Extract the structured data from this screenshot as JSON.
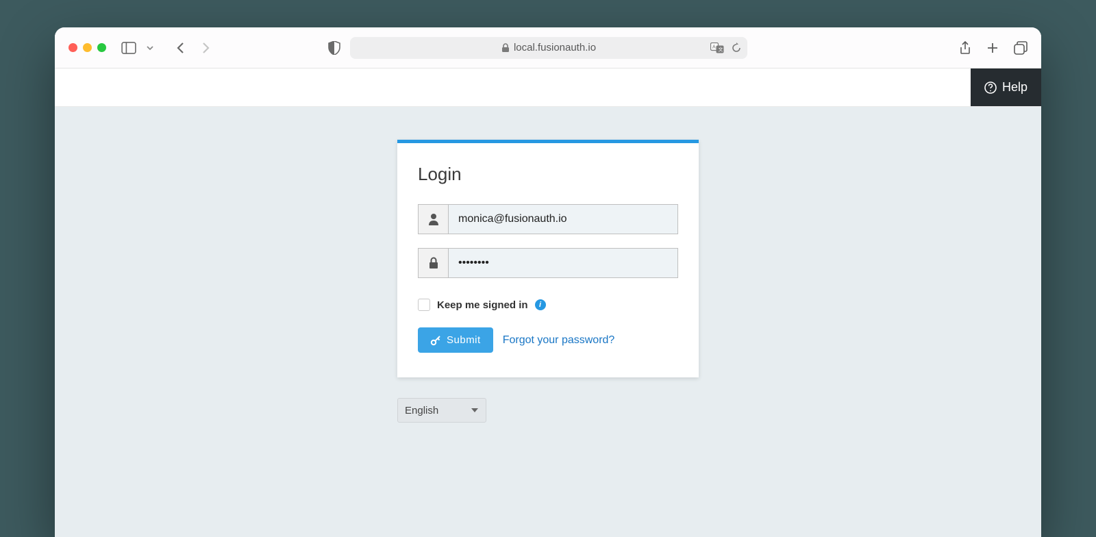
{
  "browser": {
    "url": "local.fusionauth.io"
  },
  "header": {
    "help_label": "Help"
  },
  "login": {
    "title": "Login",
    "email_value": "monica@fusionauth.io",
    "password_value": "••••••••",
    "keep_signed_in_label": "Keep me signed in",
    "submit_label": "Submit",
    "forgot_label": "Forgot your password?"
  },
  "locale": {
    "selected": "English"
  }
}
